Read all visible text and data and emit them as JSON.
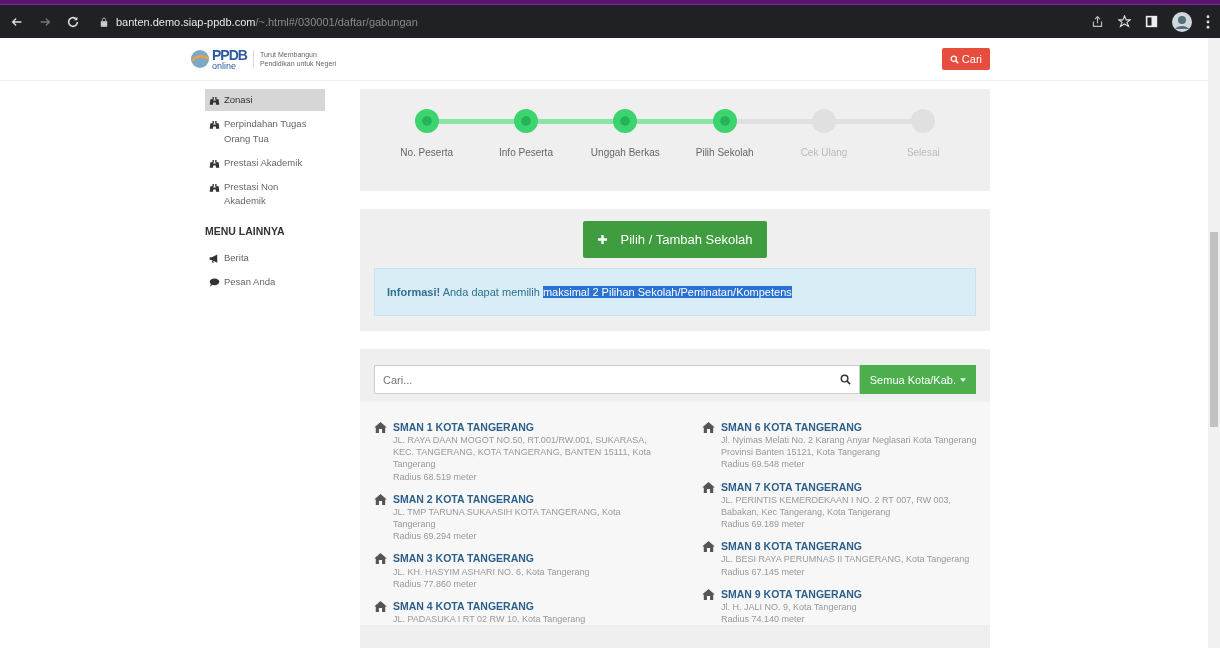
{
  "browser": {
    "url_host": "banten.demo.siap-ppdb.com",
    "url_path": "/~.html#/030001/daftar/gabungan"
  },
  "header": {
    "logo_top": "PPDB",
    "logo_bottom": "online",
    "tagline_1": "Turut Membangun",
    "tagline_2": "Pendidikan untuk Negeri",
    "search_button": "Cari"
  },
  "sidebar": {
    "items": [
      {
        "label": "Zonasi",
        "kind": "binoculars",
        "selected": true
      },
      {
        "label": "Perpindahan Tugas Orang Tua",
        "kind": "binoculars",
        "selected": false
      },
      {
        "label": "Prestasi Akademik",
        "kind": "binoculars",
        "selected": false
      },
      {
        "label": "Prestasi Non Akademik",
        "kind": "binoculars",
        "selected": false
      }
    ],
    "heading": "MENU LAINNYA",
    "other_items": [
      {
        "label": "Berita",
        "kind": "megaphone",
        "selected": false
      },
      {
        "label": "Pesan Anda",
        "kind": "comment",
        "selected": false
      }
    ]
  },
  "steps": [
    {
      "label": "No. Peserta",
      "done": true
    },
    {
      "label": "Info Peserta",
      "done": true
    },
    {
      "label": "Unggah Berkas",
      "done": true
    },
    {
      "label": "Pilih Sekolah",
      "done": true
    },
    {
      "label": "Cek Ulang",
      "done": false
    },
    {
      "label": "Selesai",
      "done": false
    }
  ],
  "add_button": "Pilih / Tambah Sekolah",
  "info": {
    "text": "**Informasi!** Anda dapat memilih ",
    "selected_text": "maksimal 2 Pilihan Sekolah/Peminatan/Kompetens"
  },
  "search": {
    "placeholder": "Cari...",
    "filter": "Semua Kota/Kab."
  },
  "schools": [
    [
      {
        "name": "SMAN 1 KOTA TANGERANG",
        "address": "JL. RAYA DAAN MOGOT NO.50, RT.001/RW.001, SUKARASA, KEC. TANGERANG, KOTA TANGERANG, BANTEN 15111, Kota Tangerang",
        "radius": "Radius 68.519 meter"
      },
      {
        "name": "SMAN 2 KOTA TANGERANG",
        "address": "JL. TMP TARUNA SUKAASIH KOTA TANGERANG, Kota Tangerang",
        "radius": "Radius 69.294 meter"
      },
      {
        "name": "SMAN 3 KOTA TANGERANG",
        "address": "JL. KH. HASYIM ASHARI NO. 6, Kota Tangerang",
        "radius": "Radius 77.860 meter"
      },
      {
        "name": "SMAN 4 KOTA TANGERANG",
        "address": "JL. PADASUKA I RT 02 RW 10, Kota Tangerang"
      }
    ],
    [
      {
        "name": "SMAN 6 KOTA TANGERANG",
        "address": "Jl. Nyimas Melati No. 2 Karang Anyar Neglasari Kota Tangerang Provinsi Banten 15121, Kota Tangerang",
        "radius": "Radius 69.548 meter"
      },
      {
        "name": "SMAN 7 KOTA TANGERANG",
        "address": "JL. PERINTIS KEMERDEKAAN I NO. 2 RT 007, RW 003, Babakan, Kec Tangerang, Kota Tangerang",
        "radius": "Radius 69.189 meter"
      },
      {
        "name": "SMAN 8 KOTA TANGERANG",
        "address": "JL. BESI RAYA PERUMNAS II TANGERANG, Kota Tangerang",
        "radius": "Radius 67.145 meter"
      },
      {
        "name": "SMAN 9 KOTA TANGERANG",
        "address": "Jl. H. JALI NO. 9, Kota Tangerang",
        "radius": "Radius 74.140 meter"
      }
    ]
  ]
}
